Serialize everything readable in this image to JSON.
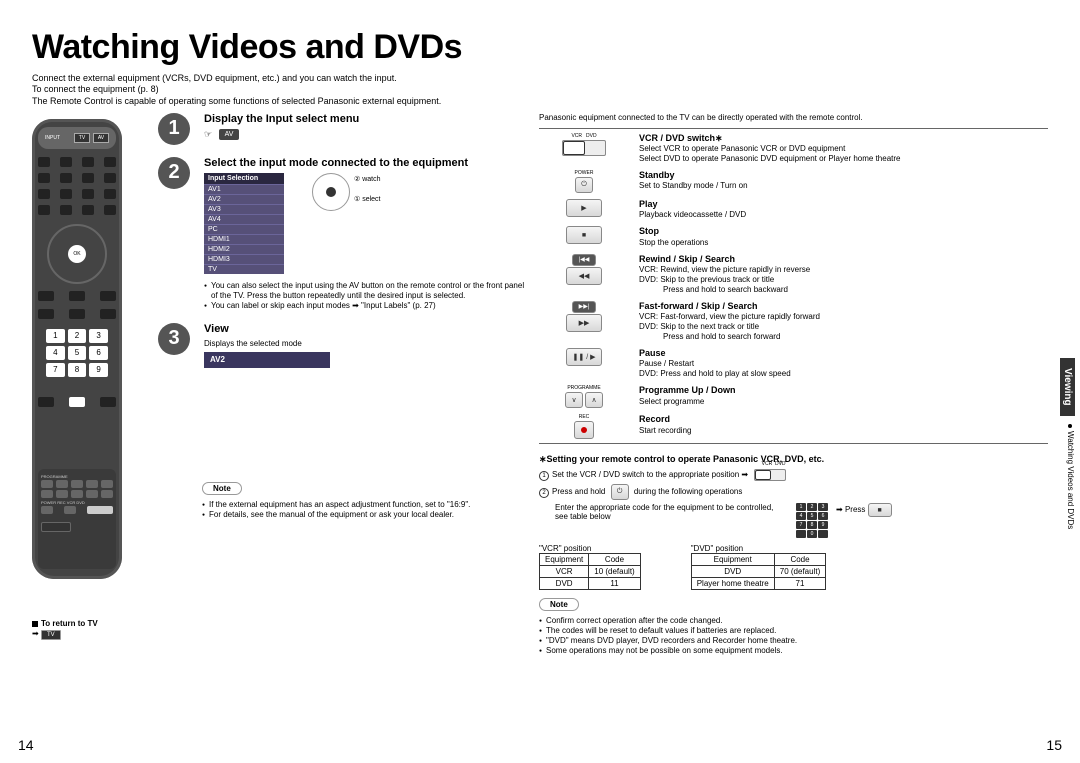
{
  "page": {
    "title": "Watching Videos and DVDs",
    "left": "14",
    "right": "15"
  },
  "intro": {
    "l1": "Connect the external equipment (VCRs, DVD equipment, etc.) and you can watch the input.",
    "l2": "To connect the equipment (p. 8)",
    "l3": "The Remote Control is capable of operating some functions of selected Panasonic external equipment."
  },
  "steps": {
    "s1": {
      "title": "Display the Input select menu",
      "btn": "AV"
    },
    "s2": {
      "title": "Select the input mode connected to the equipment",
      "panel_head": "Input Selection",
      "panel": [
        "AV1",
        "AV2",
        "AV3",
        "AV4",
        "PC",
        "HDMI1",
        "HDMI2",
        "HDMI3",
        "TV"
      ],
      "nav1": "② watch",
      "nav2": "① select",
      "note1": "You can also select the input using the AV button on the remote control or the front panel of the TV. Press the button repeatedly until the desired input is selected.",
      "note2": "You can label or skip each input modes ➡ \"Input Labels\" (p. 27)"
    },
    "s3": {
      "title": "View",
      "sub": "Displays the selected mode",
      "mode": "AV2"
    }
  },
  "return": {
    "label": "To return to TV",
    "tv": "TV"
  },
  "left_note": {
    "pill": "Note",
    "n1": "If the external equipment has an aspect adjustment function, set to \"16:9\".",
    "n2": "For details, see the manual of the equipment or ask your local dealer."
  },
  "right_intro": "Panasonic equipment connected to the TV can be directly operated with the remote control.",
  "funcs": {
    "switch": {
      "vcr": "VCR",
      "dvd": "DVD",
      "title": "VCR / DVD switch∗",
      "d1": "Select VCR to operate Panasonic VCR or DVD equipment",
      "d2": "Select DVD to operate Panasonic DVD equipment or Player home theatre"
    },
    "standby": {
      "lbl": "POWER",
      "title": "Standby",
      "d": "Set to Standby mode / Turn on"
    },
    "play": {
      "g": "▶",
      "title": "Play",
      "d": "Playback videocassette / DVD"
    },
    "stop": {
      "g": "■",
      "title": "Stop",
      "d": "Stop the operations"
    },
    "rew": {
      "g1": "|◀◀",
      "g2": "◀◀",
      "title": "Rewind / Skip / Search",
      "d1": "VCR: Rewind, view the picture rapidly in reverse",
      "d2": "DVD: Skip to the previous track or title",
      "d3": "Press and hold to search backward"
    },
    "ff": {
      "g1": "▶▶|",
      "g2": "▶▶",
      "title": "Fast-forward / Skip / Search",
      "d1": "VCR: Fast-forward, view the picture rapidly forward",
      "d2": "DVD: Skip to the next track or title",
      "d3": "Press and hold to search forward"
    },
    "pause": {
      "g": "❚❚ / ▶",
      "title": "Pause",
      "d1": "Pause / Restart",
      "d2": "DVD: Press and hold to play at slow speed"
    },
    "prog": {
      "lbl": "PROGRAMME",
      "v": "∨",
      "a": "∧",
      "title": "Programme Up / Down",
      "d": "Select programme"
    },
    "rec": {
      "lbl": "REC",
      "title": "Record",
      "d": "Start recording"
    }
  },
  "setting": {
    "title": "∗Setting your remote control to operate Panasonic VCR, DVD, etc.",
    "l1a": "Set the VCR / DVD switch to the appropriate position ➡",
    "l2a": "Press and hold",
    "l2b": "during the following operations",
    "power": "POWER",
    "l3": "Enter the appropriate code for the equipment to be controlled, see table below",
    "press": "Press",
    "stop": "■",
    "vcr_pos": "\"VCR\" position",
    "dvd_pos": "\"DVD\" position",
    "eq": "Equipment",
    "code": "Code",
    "vcr_rows": [
      [
        "VCR",
        "10 (default)"
      ],
      [
        "DVD",
        "11"
      ]
    ],
    "dvd_rows": [
      [
        "DVD",
        "70 (default)"
      ],
      [
        "Player home theatre",
        "71"
      ]
    ]
  },
  "bottom_note": {
    "pill": "Note",
    "n1": "Confirm correct operation after the code changed.",
    "n2": "The codes will be reset to default values if batteries are replaced.",
    "n3": "\"DVD\" means DVD player, DVD recorders and Recorder home theatre.",
    "n4": "Some operations may not be possible on some equipment models."
  },
  "sidetab": {
    "blk": "Viewing",
    "wht": "Watching Videos and DVDs"
  },
  "remote": {
    "tv": "TV",
    "av": "AV",
    "input": "INPUT",
    "ok": "OK"
  }
}
